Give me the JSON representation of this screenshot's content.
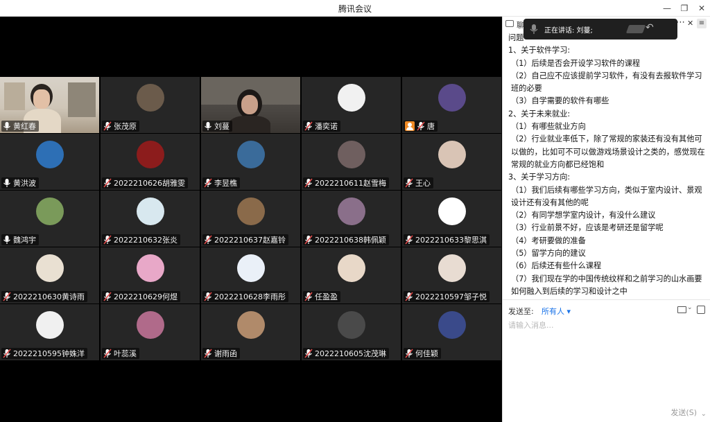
{
  "window": {
    "title": "腾讯会议"
  },
  "speaking": {
    "text": "正在讲话: 刘蔓;"
  },
  "chat": {
    "head_label": "聊",
    "top_line": "问题",
    "lines": [
      "1、关于软件学习:",
      "（1）后续是否会开设学习软件的课程",
      "（2）自己应不应该提前学习软件，有没有去报软件学习班的必要",
      "（3）自学需要的软件有哪些",
      "2、关于未来就业:",
      "（1）有哪些就业方向",
      "（2）行业就业率低下，除了常规的家装还有没有其他可以做的，比如可不可以做游戏场景设计之类的，感觉现在常规的就业方向都已经饱和",
      "3、关于学习方向:",
      "（1）我们后续有哪些学习方向，类似于室内设计、景观设计还有没有其他的呢",
      "（2）有同学想学室内设计，有没什么建议",
      "（3）行业前景不好，应该是考研还是留学呢",
      "（4）考研要做的准备",
      "（5）留学方向的建议",
      "（6）后续还有些什么课程",
      "（7）我们现在学的中国传统纹样和之前学习的山水画要如何融入到后续的学习和设计之中"
    ],
    "send_to_label": "发送至:",
    "recipient": "所有人",
    "input_placeholder": "请输入消息...",
    "send_button": "发送(S)"
  },
  "participants": [
    {
      "name": "黄红春",
      "kind": "video",
      "mic": "on"
    },
    {
      "name": "张茂原",
      "kind": "avatar",
      "mic": "muted",
      "color": "#6b5b4b"
    },
    {
      "name": "刘蔓",
      "kind": "video",
      "mic": "on",
      "active": true
    },
    {
      "name": "潘奕诺",
      "kind": "avatar",
      "mic": "muted",
      "color": "#f1f1f1"
    },
    {
      "name": "唐",
      "kind": "avatar",
      "mic": "muted",
      "color": "#5a4a8a",
      "host": true
    },
    {
      "name": "黄洪波",
      "kind": "avatar",
      "mic": "on",
      "color": "#2d6fb5"
    },
    {
      "name": "2022210626胡雅雯",
      "kind": "avatar",
      "mic": "muted",
      "color": "#8c1c1c"
    },
    {
      "name": "李昱樵",
      "kind": "avatar",
      "mic": "muted",
      "color": "#3a6b9a"
    },
    {
      "name": "2022210611赵雪梅",
      "kind": "avatar",
      "mic": "muted",
      "color": "#6f5f5f"
    },
    {
      "name": "王心",
      "kind": "avatar",
      "mic": "muted",
      "color": "#d9c4b5"
    },
    {
      "name": "魏鸿宇",
      "kind": "avatar",
      "mic": "on",
      "color": "#7a9a5a"
    },
    {
      "name": "2022210632张炎",
      "kind": "avatar",
      "mic": "muted",
      "color": "#d8e8ef"
    },
    {
      "name": "2022210637赵嘉铃",
      "kind": "avatar",
      "mic": "muted",
      "color": "#8a6a4a"
    },
    {
      "name": "2022210638韩佩颖",
      "kind": "avatar",
      "mic": "muted",
      "color": "#8a6f8a"
    },
    {
      "name": "2022210633黎思淇",
      "kind": "avatar",
      "mic": "muted",
      "color": "#ffffff"
    },
    {
      "name": "2022210630黄诗雨",
      "kind": "avatar",
      "mic": "muted",
      "color": "#e9e0d2"
    },
    {
      "name": "2022210629何煜",
      "kind": "avatar",
      "mic": "muted",
      "color": "#e8a8c8"
    },
    {
      "name": "2022210628李雨彤",
      "kind": "avatar",
      "mic": "muted",
      "color": "#eaf0f8"
    },
    {
      "name": "任盈盈",
      "kind": "avatar",
      "mic": "muted",
      "color": "#e8d8c8"
    },
    {
      "name": "2022210597邹子悦",
      "kind": "avatar",
      "mic": "muted",
      "color": "#e8dcd2"
    },
    {
      "name": "2022210595钟姝洋",
      "kind": "avatar",
      "mic": "muted",
      "color": "#f0f0f0"
    },
    {
      "name": "叶蕊溪",
      "kind": "avatar",
      "mic": "muted",
      "color": "#b06a8a"
    },
    {
      "name": "谢雨函",
      "kind": "avatar",
      "mic": "muted",
      "color": "#b08a6a"
    },
    {
      "name": "2022210605沈茂琳",
      "kind": "avatar",
      "mic": "muted",
      "color": "#4a4a4a"
    },
    {
      "name": "何佳颖",
      "kind": "avatar",
      "mic": "muted",
      "color": "#3a4a8a"
    }
  ]
}
